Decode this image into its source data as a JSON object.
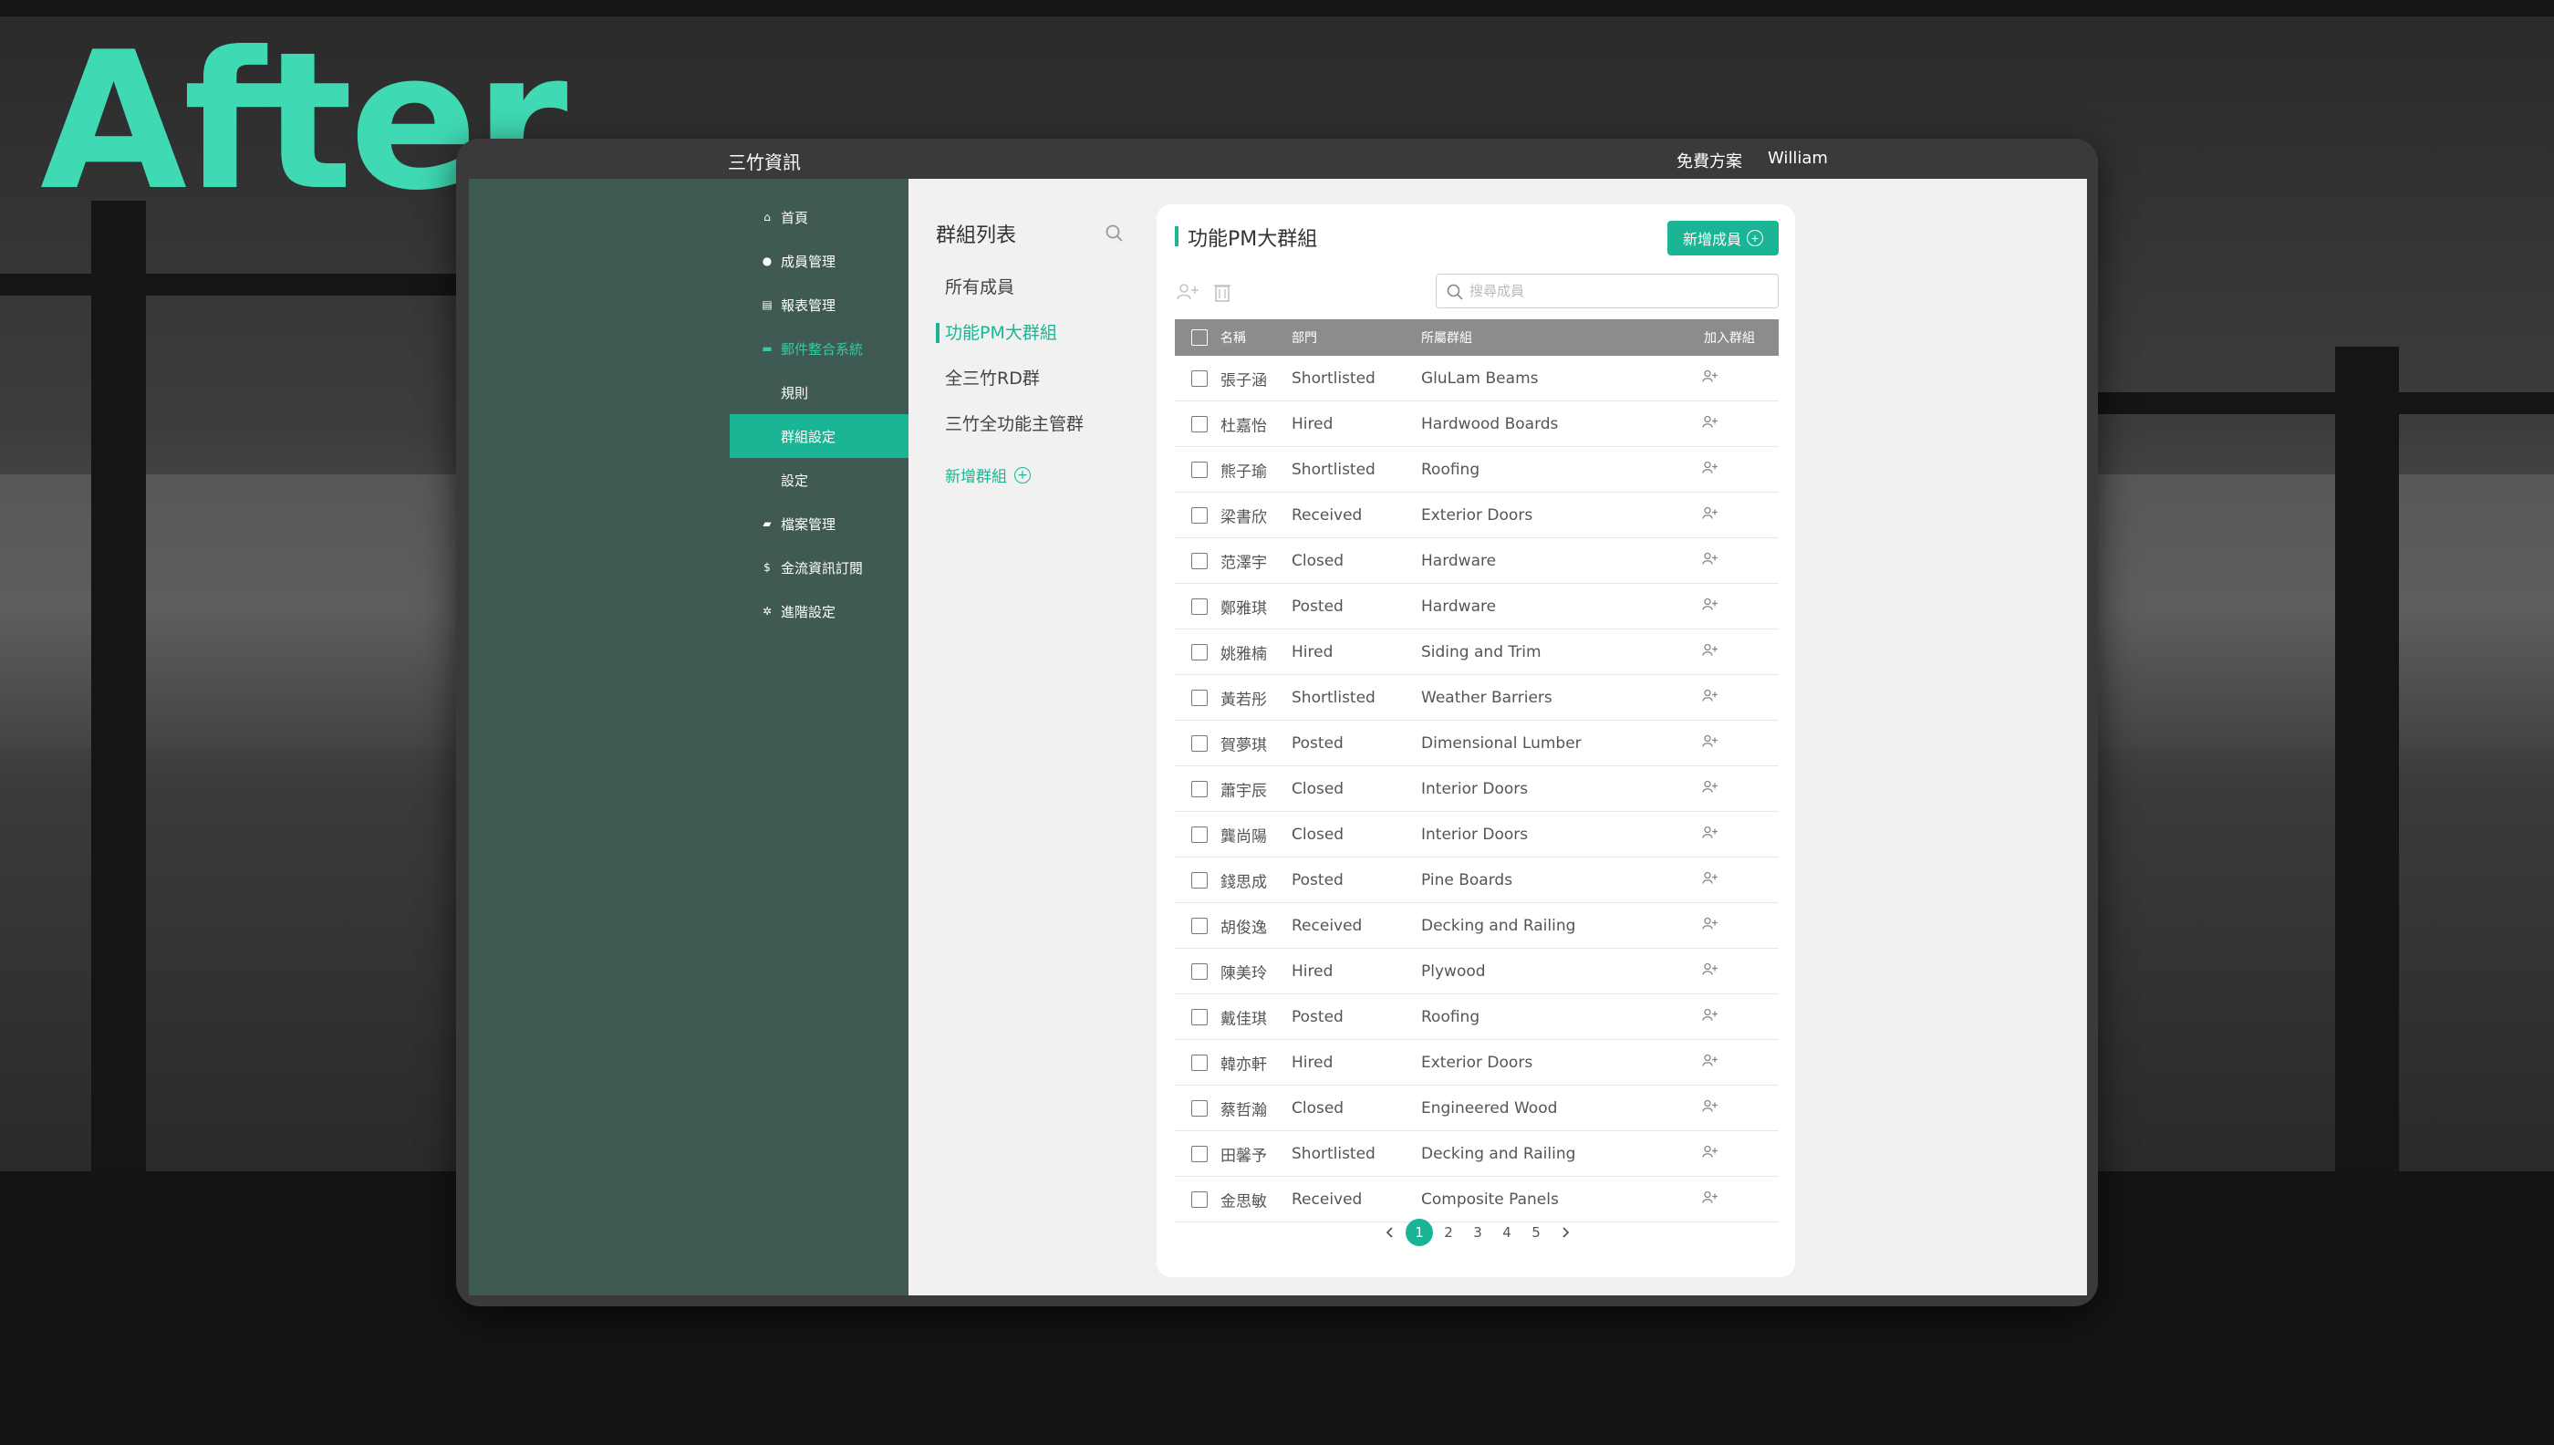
{
  "headline": "After",
  "topbar": {
    "brand": "三竹資訊",
    "plan": "免費方案",
    "user": "William"
  },
  "sidebar": {
    "items": [
      {
        "label": "首頁",
        "icon": "home-icon",
        "level": 0,
        "state": "normal"
      },
      {
        "label": "成員管理",
        "icon": "user-icon",
        "level": 0,
        "state": "normal"
      },
      {
        "label": "報表管理",
        "icon": "report-icon",
        "level": 0,
        "state": "normal"
      },
      {
        "label": "郵件整合系統",
        "icon": "mail-icon",
        "level": 0,
        "state": "expanded"
      },
      {
        "label": "規則",
        "icon": "",
        "level": 1,
        "state": "normal"
      },
      {
        "label": "群組設定",
        "icon": "",
        "level": 1,
        "state": "active"
      },
      {
        "label": "設定",
        "icon": "",
        "level": 1,
        "state": "normal"
      },
      {
        "label": "檔案管理",
        "icon": "folder-icon",
        "level": 0,
        "state": "normal"
      },
      {
        "label": "金流資訊訂閱",
        "icon": "dollar-icon",
        "level": 0,
        "state": "normal"
      },
      {
        "label": "進階設定",
        "icon": "gear-icon",
        "level": 0,
        "state": "normal"
      }
    ]
  },
  "groups": {
    "heading": "群組列表",
    "items": [
      "所有成員",
      "功能PM大群組",
      "全三竹RD群",
      "三竹全功能主管群"
    ],
    "active_index": 1,
    "add_label": "新增群組"
  },
  "panel": {
    "title": "功能PM大群組",
    "add_member_label": "新增成員",
    "search_placeholder": "搜尋成員",
    "columns": {
      "name": "名稱",
      "dept": "部門",
      "group": "所屬群組",
      "join": "加入群組"
    },
    "rows": [
      {
        "name": "張子涵",
        "dept": "Shortlisted",
        "group": "GluLam Beams"
      },
      {
        "name": "杜嘉怡",
        "dept": "Hired",
        "group": "Hardwood Boards"
      },
      {
        "name": "熊子瑜",
        "dept": "Shortlisted",
        "group": "Roofing"
      },
      {
        "name": "梁書欣",
        "dept": "Received",
        "group": "Exterior Doors"
      },
      {
        "name": "范澤宇",
        "dept": "Closed",
        "group": "Hardware"
      },
      {
        "name": "鄭雅琪",
        "dept": "Posted",
        "group": "Hardware"
      },
      {
        "name": "姚雅楠",
        "dept": "Hired",
        "group": "Siding and Trim"
      },
      {
        "name": "黃若彤",
        "dept": "Shortlisted",
        "group": "Weather Barriers"
      },
      {
        "name": "賀夢琪",
        "dept": "Posted",
        "group": "Dimensional Lumber"
      },
      {
        "name": "蕭宇辰",
        "dept": "Closed",
        "group": "Interior Doors"
      },
      {
        "name": "龔尚陽",
        "dept": "Closed",
        "group": "Interior Doors"
      },
      {
        "name": "錢思成",
        "dept": "Posted",
        "group": "Pine Boards"
      },
      {
        "name": "胡俊逸",
        "dept": "Received",
        "group": "Decking and Railing"
      },
      {
        "name": "陳美玲",
        "dept": "Hired",
        "group": "Plywood"
      },
      {
        "name": "戴佳琪",
        "dept": "Posted",
        "group": "Roofing"
      },
      {
        "name": "韓亦軒",
        "dept": "Hired",
        "group": "Exterior Doors"
      },
      {
        "name": "蔡哲瀚",
        "dept": "Closed",
        "group": "Engineered Wood"
      },
      {
        "name": "田馨予",
        "dept": "Shortlisted",
        "group": "Decking and Railing"
      },
      {
        "name": "金思敏",
        "dept": "Received",
        "group": "Composite Panels"
      }
    ],
    "pages": [
      "1",
      "2",
      "3",
      "4",
      "5"
    ],
    "current_page": "1"
  },
  "colors": {
    "accent": "#19b594",
    "headline": "#3fd9b3",
    "sidebar": "#3e5a53",
    "header": "#8c8c8c"
  }
}
